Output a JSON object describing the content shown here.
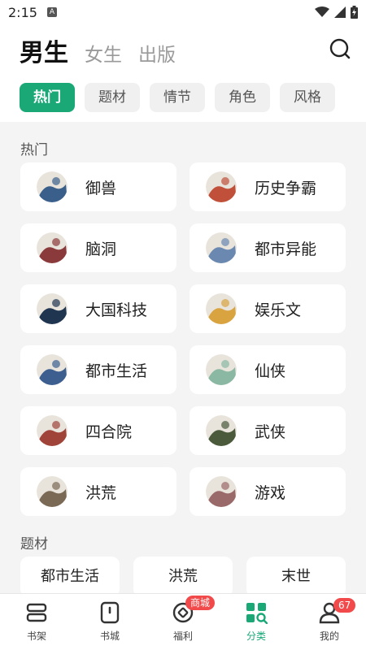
{
  "status": {
    "time": "2:15",
    "notif_icon": "A"
  },
  "header": {
    "tabs": [
      {
        "label": "男生",
        "active": true
      },
      {
        "label": "女生",
        "active": false
      },
      {
        "label": "出版",
        "active": false
      }
    ],
    "chips": [
      {
        "label": "热门",
        "active": true
      },
      {
        "label": "题材",
        "active": false
      },
      {
        "label": "情节",
        "active": false
      },
      {
        "label": "角色",
        "active": false
      },
      {
        "label": "风格",
        "active": false
      }
    ]
  },
  "hot": {
    "title": "热门",
    "items": [
      {
        "label": "御兽",
        "icon": "beast-avatar-icon",
        "color": "#3a5f8a"
      },
      {
        "label": "历史争霸",
        "icon": "flag-avatar-icon",
        "color": "#c0503a"
      },
      {
        "label": "脑洞",
        "icon": "brain-avatar-icon",
        "color": "#8a3a3a"
      },
      {
        "label": "都市异能",
        "icon": "city-avatar-icon",
        "color": "#6a88b0"
      },
      {
        "label": "大国科技",
        "icon": "satellite-avatar-icon",
        "color": "#1f3550"
      },
      {
        "label": "娱乐文",
        "icon": "star-avatar-icon",
        "color": "#d9a340"
      },
      {
        "label": "都市生活",
        "icon": "desk-avatar-icon",
        "color": "#3c5f90"
      },
      {
        "label": "仙侠",
        "icon": "mountain-avatar-icon",
        "color": "#8ab8a2"
      },
      {
        "label": "四合院",
        "icon": "house-avatar-icon",
        "color": "#a0443a"
      },
      {
        "label": "武侠",
        "icon": "swordsman-avatar-icon",
        "color": "#4a5a3a"
      },
      {
        "label": "洪荒",
        "icon": "axe-avatar-icon",
        "color": "#7a6a55"
      },
      {
        "label": "游戏",
        "icon": "gamer-avatar-icon",
        "color": "#9a6a6a"
      }
    ]
  },
  "topics": {
    "title": "题材",
    "items": [
      {
        "label": "都市生活"
      },
      {
        "label": "洪荒"
      },
      {
        "label": "末世"
      }
    ]
  },
  "nav": {
    "items": [
      {
        "label": "书架",
        "icon": "bookshelf-icon",
        "active": false
      },
      {
        "label": "书城",
        "icon": "bookstore-icon",
        "active": false
      },
      {
        "label": "福利",
        "icon": "coin-icon",
        "active": false,
        "badge": "商城"
      },
      {
        "label": "分类",
        "icon": "category-icon",
        "active": true
      },
      {
        "label": "我的",
        "icon": "profile-icon",
        "active": false,
        "badge": "67"
      }
    ]
  },
  "colors": {
    "accent": "#1aa877",
    "badge": "#f24a4a"
  }
}
